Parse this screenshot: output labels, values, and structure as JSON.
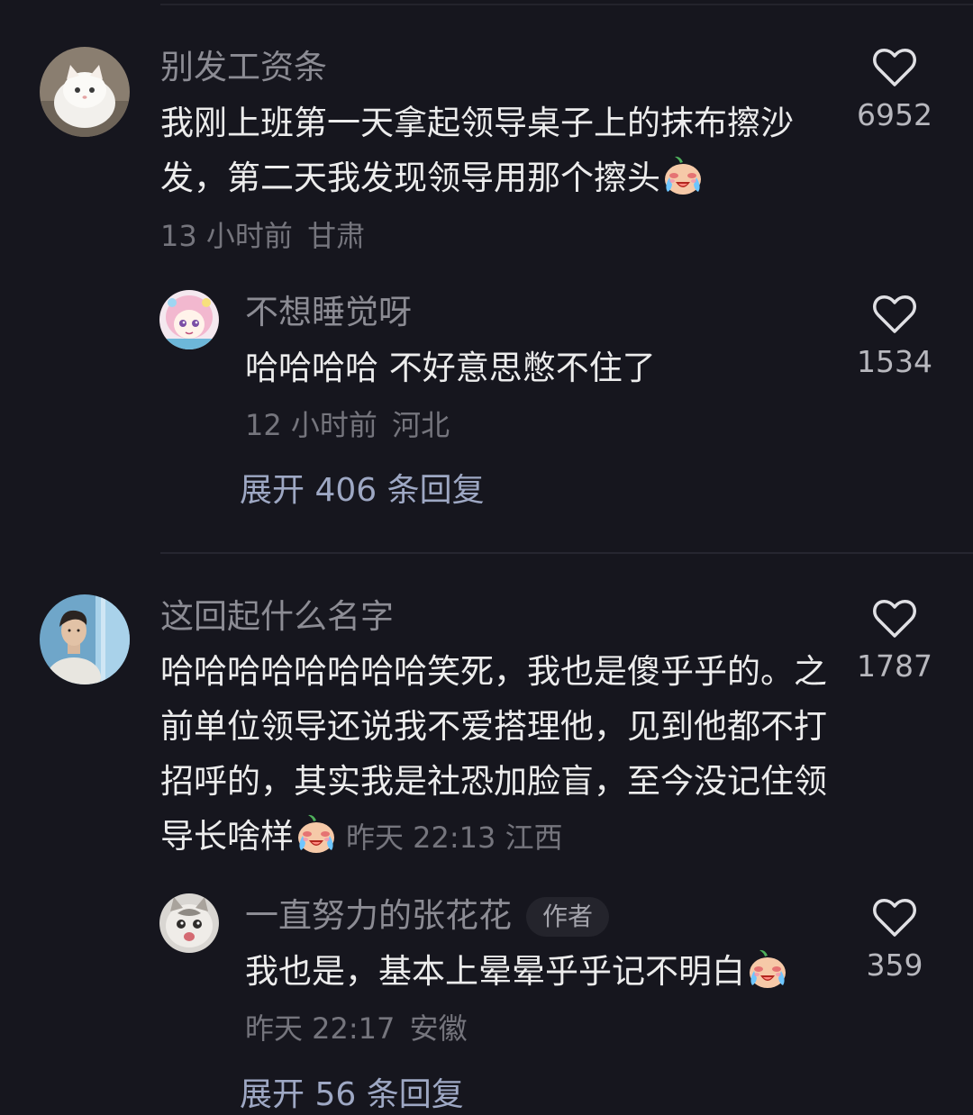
{
  "comments": [
    {
      "user": "别发工资条",
      "text": "我刚上班第一天拿起领导桌子上的抹布擦沙发，第二天我发现领导用那个擦头",
      "time": "13 小时前",
      "location": "甘肃",
      "likes": "6952",
      "reply": {
        "user": "不想睡觉呀",
        "text": "哈哈哈哈 不好意思憋不住了",
        "time": "12 小时前",
        "location": "河北",
        "likes": "1534"
      },
      "expand_label": "展开 406 条回复"
    },
    {
      "user": "这回起什么名字",
      "text": "哈哈哈哈哈哈哈哈笑死，我也是傻乎乎的。之前单位领导还说我不爱搭理他，见到他都不打招呼的，其实我是社恐加脸盲，至今没记住领导长啥样",
      "time": "昨天 22:13",
      "location": "江西",
      "likes": "1787",
      "reply": {
        "user": "一直努力的张花花",
        "badge": "作者",
        "text": "我也是，基本上晕晕乎乎记不明白",
        "time": "昨天 22:17",
        "location": "安徽",
        "likes": "359"
      },
      "expand_label": "展开 56 条回复"
    }
  ],
  "icons": {
    "like": "heart-outline-icon",
    "emoji": "crying-laughing-emoji-icon"
  },
  "colors": {
    "background": "#16161e",
    "text": "#ececec",
    "username": "#8c8c94",
    "meta": "#75757d",
    "expand_link": "#9ea8c4"
  }
}
